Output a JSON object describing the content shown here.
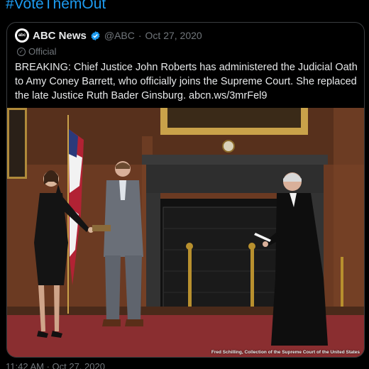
{
  "tweet": {
    "hashtag": "#VoteThemOut",
    "timestamp": "11:42 AM · Oct 27, 2020"
  },
  "quote": {
    "author_name": "ABC News",
    "handle": "@ABC",
    "separator": "·",
    "date": "Oct 27, 2020",
    "avatar_text": "abc",
    "label": "Official",
    "text": "BREAKING: Chief Justice John Roberts has administered the Judicial Oath to Amy Coney Barrett, who officially joins the Supreme Court. She replaced the late Justice Ruth Bader Ginsburg. abcn.ws/3mrFel9",
    "photo_credit": "Fred Schilling, Collection of the Supreme Court of the United States"
  },
  "colors": {
    "accent": "#1d9bf0",
    "background": "#000000",
    "muted_text": "#71767b",
    "border": "#3a3d40"
  }
}
